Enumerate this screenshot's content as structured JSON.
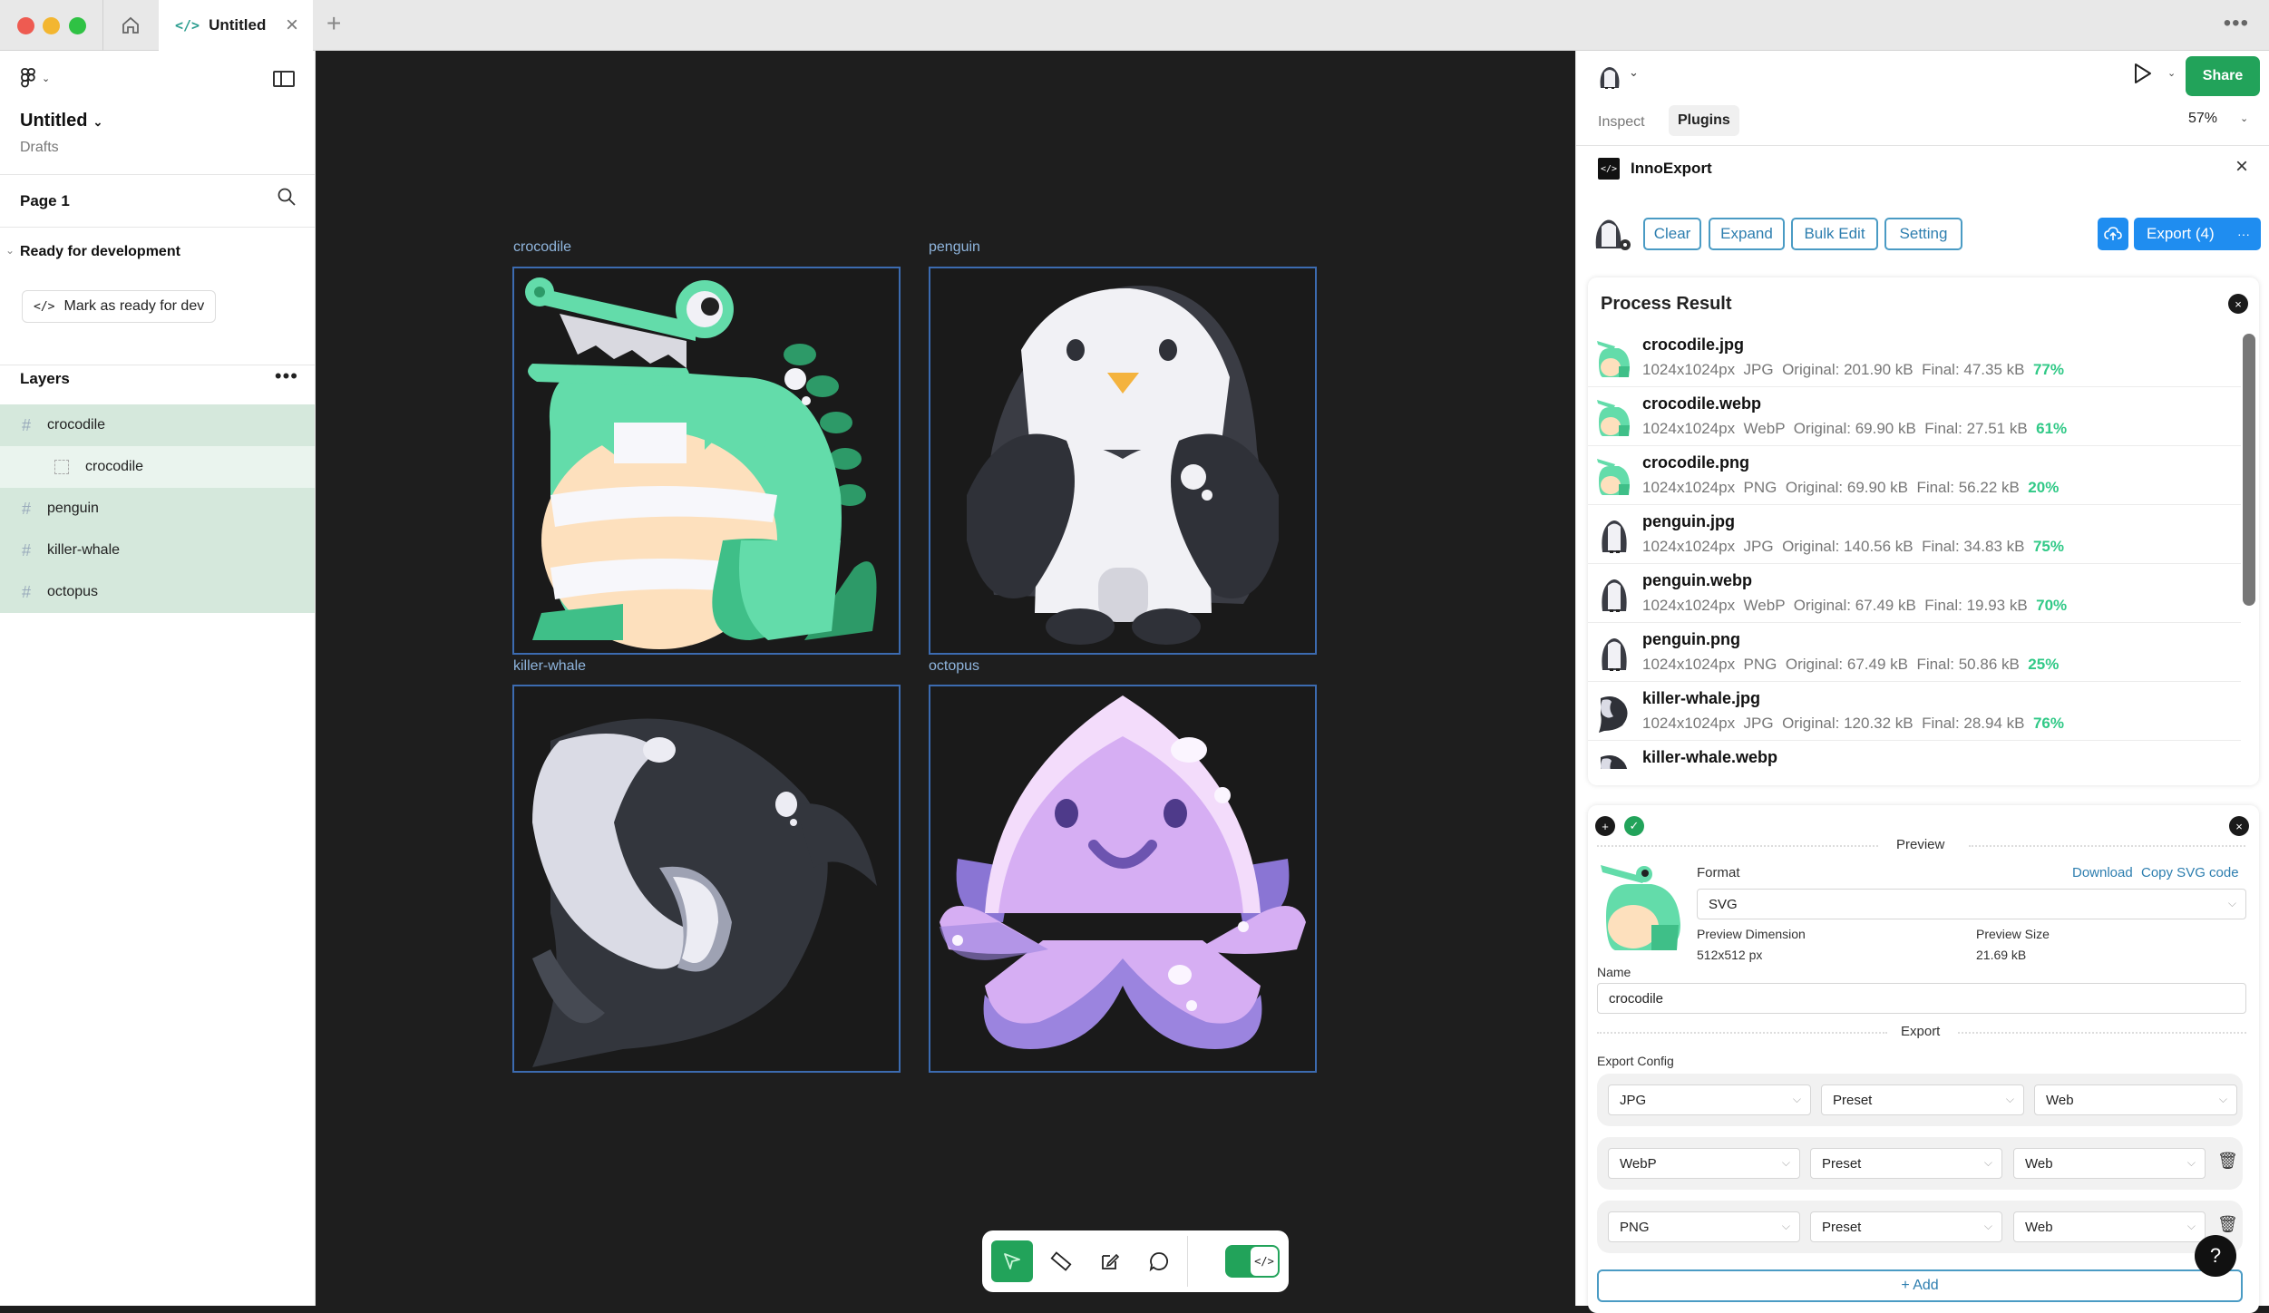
{
  "titlebar": {
    "tab_title": "Untitled",
    "tab_icon": "code-icon",
    "new_tab": "+",
    "more": "•••"
  },
  "sidebar": {
    "file_title": "Untitled",
    "file_location": "Drafts",
    "page": "Page 1",
    "section": "Ready for development",
    "mark_button": "Mark as ready for dev",
    "layers_label": "Layers",
    "layers": [
      {
        "name": "crocodile",
        "state": "selected"
      },
      {
        "name": "crocodile",
        "state": "child"
      },
      {
        "name": "penguin",
        "state": "selected"
      },
      {
        "name": "killer-whale",
        "state": "selected"
      },
      {
        "name": "octopus",
        "state": "selected"
      }
    ]
  },
  "canvas": {
    "frames": [
      {
        "label": "crocodile"
      },
      {
        "label": "penguin"
      },
      {
        "label": "killer-whale"
      },
      {
        "label": "octopus"
      }
    ],
    "toolbar": {
      "tools": [
        "move-icon",
        "ruler-icon",
        "annotate-icon",
        "comment-icon"
      ],
      "dev_mode": "</>"
    }
  },
  "right_panel": {
    "share": "Share",
    "tabs": [
      "Inspect",
      "Plugins"
    ],
    "active_tab": "Plugins",
    "zoom": "57%",
    "plugin": {
      "name": "InnoExport",
      "icon": "</>",
      "actions": {
        "clear": "Clear",
        "expand": "Expand",
        "bulk_edit": "Bulk Edit",
        "setting": "Setting",
        "export": "Export (4)",
        "export_more": "···"
      },
      "process_result": {
        "title": "Process Result",
        "items": [
          {
            "name": "crocodile.jpg",
            "dims": "1024x1024px",
            "format": "JPG",
            "original": "Original: 201.90 kB",
            "final": "Final: 47.35 kB",
            "pct": "77%",
            "thumb": "crocodile"
          },
          {
            "name": "crocodile.webp",
            "dims": "1024x1024px",
            "format": "WebP",
            "original": "Original: 69.90 kB",
            "final": "Final: 27.51 kB",
            "pct": "61%",
            "thumb": "crocodile"
          },
          {
            "name": "crocodile.png",
            "dims": "1024x1024px",
            "format": "PNG",
            "original": "Original: 69.90 kB",
            "final": "Final: 56.22 kB",
            "pct": "20%",
            "thumb": "crocodile"
          },
          {
            "name": "penguin.jpg",
            "dims": "1024x1024px",
            "format": "JPG",
            "original": "Original: 140.56 kB",
            "final": "Final: 34.83 kB",
            "pct": "75%",
            "thumb": "penguin"
          },
          {
            "name": "penguin.webp",
            "dims": "1024x1024px",
            "format": "WebP",
            "original": "Original: 67.49 kB",
            "final": "Final: 19.93 kB",
            "pct": "70%",
            "thumb": "penguin"
          },
          {
            "name": "penguin.png",
            "dims": "1024x1024px",
            "format": "PNG",
            "original": "Original: 67.49 kB",
            "final": "Final: 50.86 kB",
            "pct": "25%",
            "thumb": "penguin"
          },
          {
            "name": "killer-whale.jpg",
            "dims": "1024x1024px",
            "format": "JPG",
            "original": "Original: 120.32 kB",
            "final": "Final: 28.94 kB",
            "pct": "76%",
            "thumb": "whale"
          },
          {
            "name": "killer-whale.webp",
            "dims": "",
            "format": "",
            "original": "",
            "final": "",
            "pct": "",
            "thumb": "whale"
          }
        ]
      },
      "preview": {
        "section_label": "Preview",
        "format_label": "Format",
        "download": "Download",
        "copy_svg": "Copy SVG code",
        "format_value": "SVG",
        "dimension_label": "Preview Dimension",
        "dimension_value": "512x512 px",
        "size_label": "Preview Size",
        "size_value": "21.69 kB",
        "name_label": "Name",
        "name_value": "crocodile",
        "export_label": "Export",
        "export_config_label": "Export Config",
        "configs": [
          {
            "format": "JPG",
            "preset": "Preset",
            "target": "Web",
            "deletable": false
          },
          {
            "format": "WebP",
            "preset": "Preset",
            "target": "Web",
            "deletable": true
          },
          {
            "format": "PNG",
            "preset": "Preset",
            "target": "Web",
            "deletable": true
          }
        ],
        "add": "+ Add"
      }
    }
  },
  "help": "?",
  "colors": {
    "accent_green": "#22a35a",
    "accent_blue": "#1f8df0",
    "savings_green": "#31c987",
    "frame_outline": "#3c6bb0"
  }
}
